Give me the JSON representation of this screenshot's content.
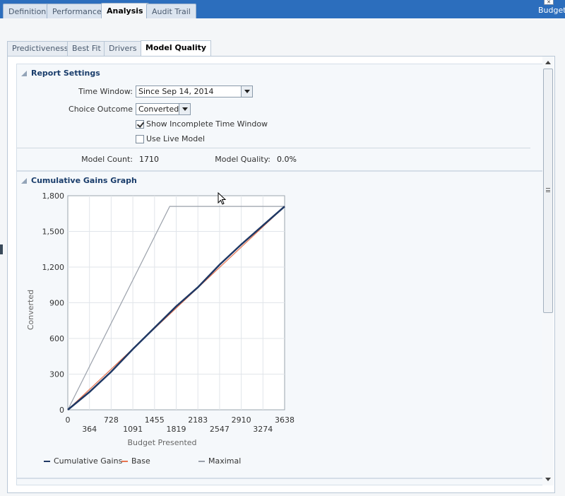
{
  "top_tabs": [
    "Definition",
    "Performance",
    "Analysis",
    "Audit Trail"
  ],
  "budget_label": "Budget",
  "sub_tabs": [
    "Predictiveness",
    "Best Fit",
    "Drivers",
    "Model Quality"
  ],
  "report_settings": {
    "title": "Report Settings",
    "time_window_label": "Time Window:",
    "time_window_value": "Since Sep 14, 2014",
    "choice_outcome_label": "Choice Outcome",
    "choice_outcome_value": "Converted",
    "show_incomplete_label": "Show Incomplete Time Window",
    "show_incomplete_checked": true,
    "use_live_label": "Use Live Model",
    "use_live_checked": false,
    "model_count_label": "Model Count:",
    "model_count_value": "1710",
    "model_quality_label": "Model Quality:",
    "model_quality_value": "0.0%"
  },
  "graph_section_title": "Cumulative Gains Graph",
  "chart_data": {
    "type": "line",
    "xlabel": "Budget Presented",
    "ylabel": "Converted",
    "xlim": [
      0,
      3638
    ],
    "ylim": [
      0,
      1800
    ],
    "x_ticks_top": [
      "0",
      "728",
      "1455",
      "2183",
      "2910",
      "3638"
    ],
    "x_ticks_bottom": [
      "364",
      "1091",
      "1819",
      "2547",
      "3274"
    ],
    "y_ticks": [
      "0",
      "300",
      "600",
      "900",
      "1,200",
      "1,500",
      "1,800"
    ],
    "grid": true,
    "legend": "bottom",
    "series": [
      {
        "name": "Cumulative Gains",
        "color": "#1f3864",
        "x": [
          0,
          364,
          728,
          1091,
          1455,
          1819,
          2183,
          2547,
          2910,
          3274,
          3638
        ],
        "y": [
          0,
          150,
          320,
          510,
          690,
          870,
          1030,
          1220,
          1390,
          1550,
          1710
        ]
      },
      {
        "name": "Base",
        "color": "#e8744f",
        "x": [
          0,
          3638
        ],
        "y": [
          0,
          1710
        ]
      },
      {
        "name": "Maximal",
        "color": "#9aa0aa",
        "x": [
          0,
          1710,
          3638
        ],
        "y": [
          0,
          1710,
          1710
        ]
      }
    ]
  }
}
